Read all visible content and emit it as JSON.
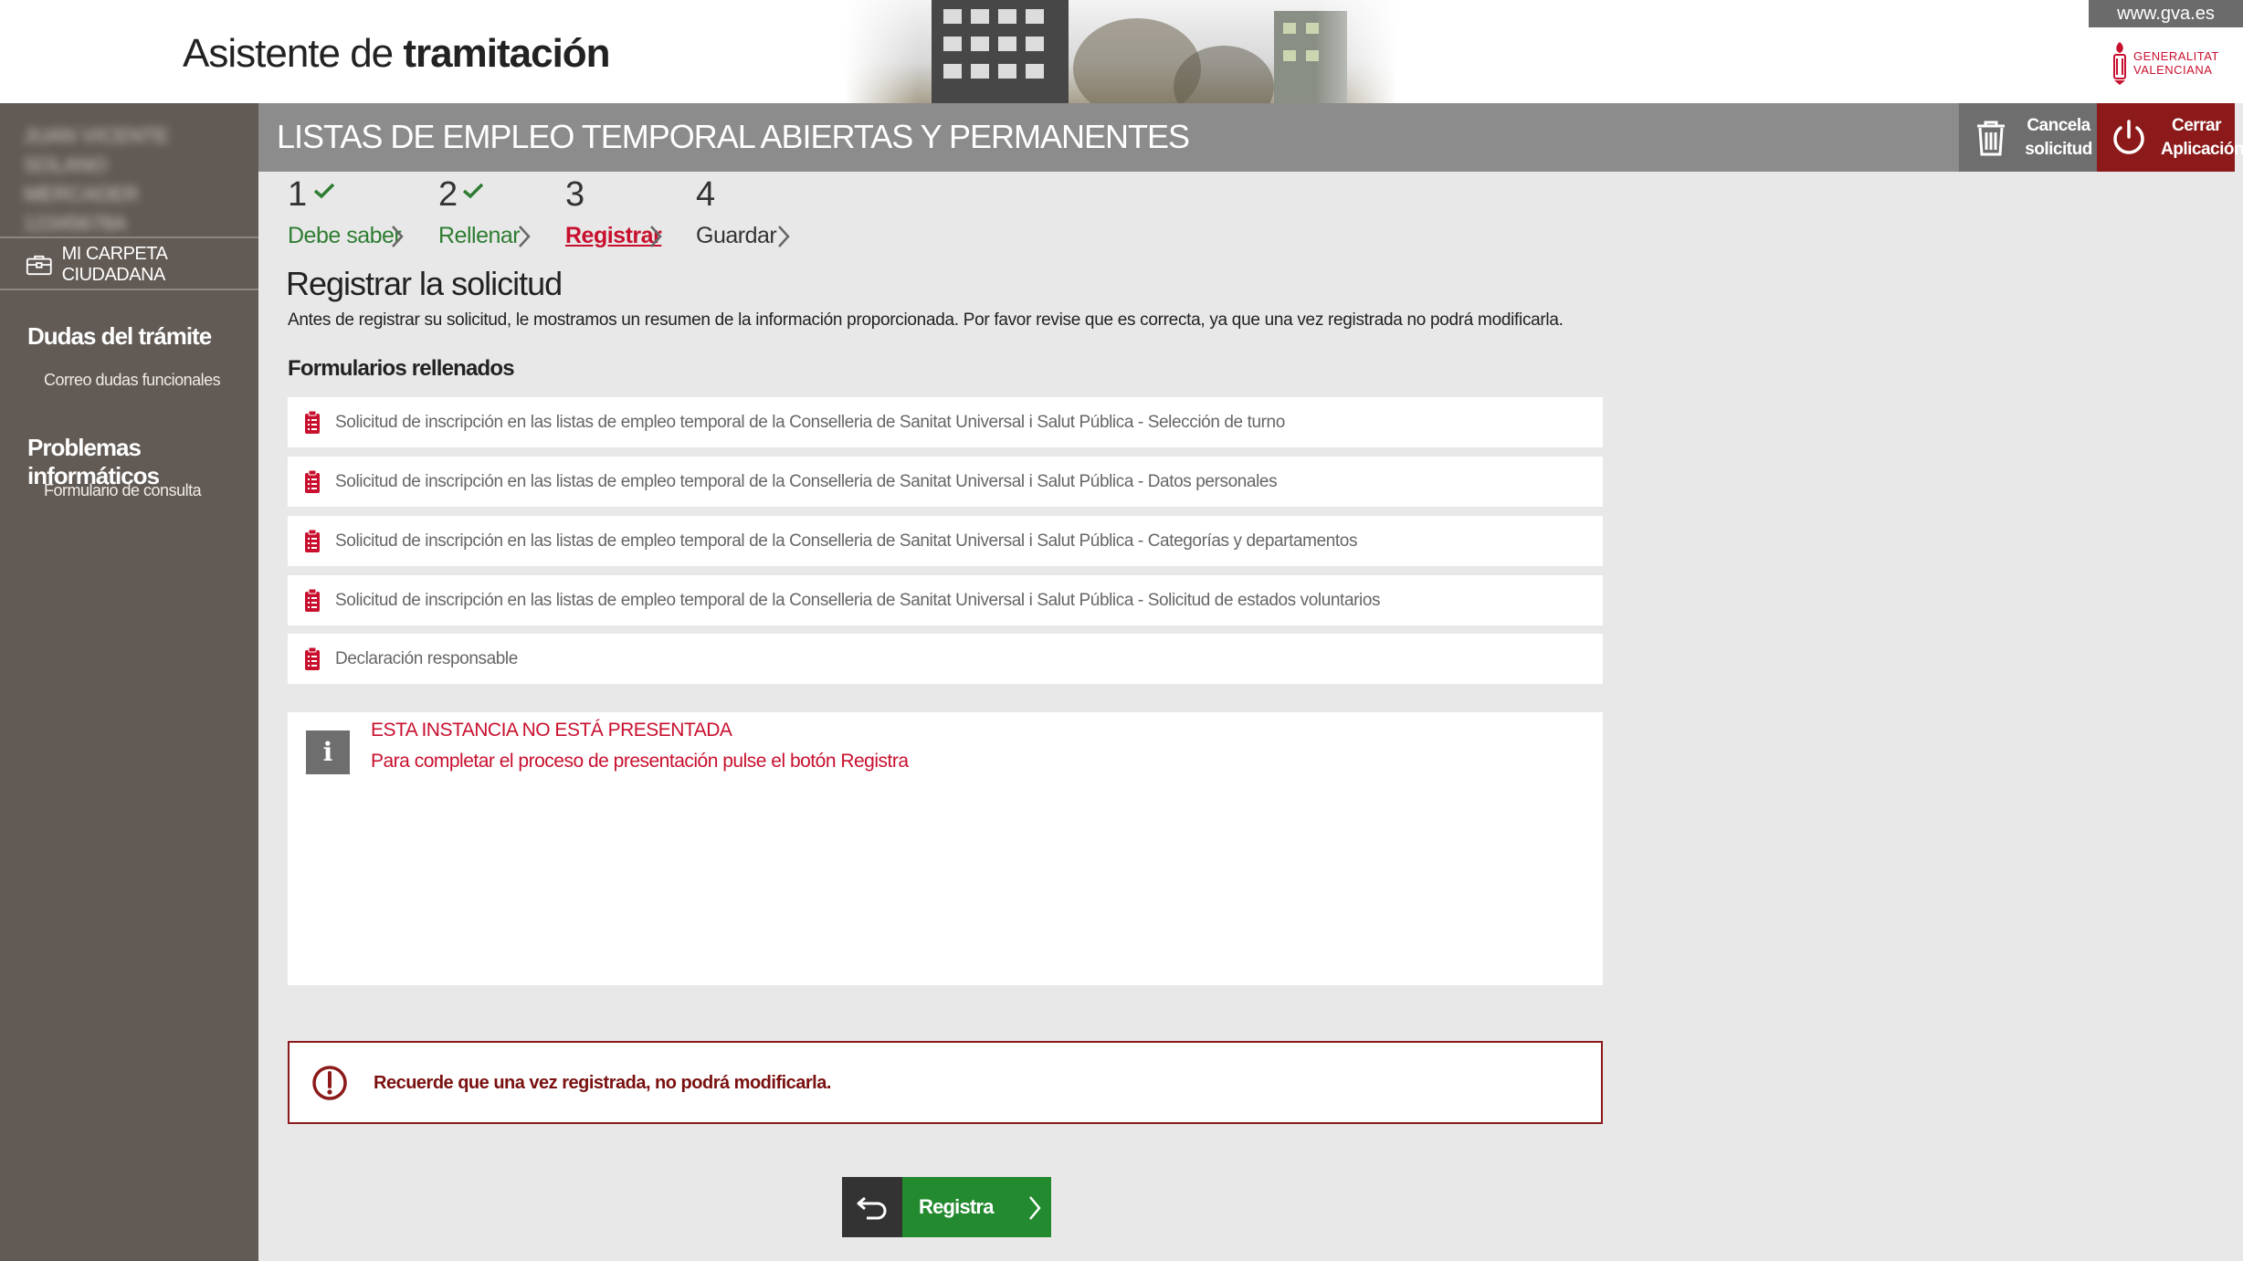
{
  "header": {
    "title_prefix": "Asistente de",
    "title_bold": "tramitación",
    "gva_link": "www.gva.es",
    "logo_line1": "GENERALITAT",
    "logo_line2": "VALENCIANA"
  },
  "sidebar": {
    "user_line1": "JUAN VICENTE SOLANO",
    "user_line2": "MERCADER",
    "user_line3": "12345678A",
    "carpeta_label": "MI CARPETA CIUDADANA",
    "sections": [
      {
        "heading": "Dudas del trámite",
        "link": "Correo dudas funcionales"
      },
      {
        "heading": "Problemas informáticos",
        "link": "Formulario de consulta"
      }
    ]
  },
  "titlebar": {
    "title": "LISTAS DE EMPLEO TEMPORAL ABIERTAS Y PERMANENTES",
    "cancel_line1": "Cancela",
    "cancel_line2": "solicitud",
    "close_line1": "Cerrar",
    "close_line2": "Aplicación"
  },
  "steps": [
    {
      "num": "1",
      "label": "Debe saber",
      "state": "done"
    },
    {
      "num": "2",
      "label": "Rellenar",
      "state": "done"
    },
    {
      "num": "3",
      "label": "Registrar",
      "state": "active"
    },
    {
      "num": "4",
      "label": "Guardar",
      "state": "todo"
    }
  ],
  "main": {
    "title": "Registrar la solicitud",
    "intro": "Antes de registrar su solicitud, le mostramos un resumen de la información proporcionada. Por favor revise que es correcta, ya que una vez registrada no podrá modificarla.",
    "forms_heading": "Formularios rellenados",
    "forms": [
      "Solicitud de inscripción en las listas de empleo temporal de la Conselleria de Sanitat Universal i Salut Pública - Selección de turno",
      "Solicitud de inscripción en las listas de empleo temporal de la Conselleria de Sanitat Universal i Salut Pública - Datos personales",
      "Solicitud de inscripción en las listas de empleo temporal de la Conselleria de Sanitat Universal i Salut Pública - Categorías y departamentos",
      "Solicitud de inscripción en las listas de empleo temporal de la Conselleria de Sanitat Universal i Salut Pública - Solicitud de estados voluntarios",
      "Declaración responsable"
    ],
    "info_line1": "ESTA INSTANCIA NO ESTÁ PRESENTADA",
    "info_line2": "Para completar el proceso de presentación pulse el botón Registra",
    "warning": "Recuerde que una vez registrada, no podrá modificarla.",
    "register_button": "Registra"
  },
  "colors": {
    "sidebar_bg": "#615a55",
    "titlebar_bg": "#8c8c8c",
    "close_bg": "#8c1a1a",
    "done_green": "#2e7d32",
    "active_red": "#c8102e",
    "register_green": "#238a2f"
  },
  "icons": {
    "cancel": "trash-icon",
    "close": "power-icon",
    "form": "clipboard-list-icon",
    "info": "info-icon",
    "warning": "exclamation-circle-icon",
    "back": "return-arrow-icon",
    "next": "chevron-right-icon",
    "carpeta": "briefcase-icon",
    "done": "checkmark-icon"
  }
}
